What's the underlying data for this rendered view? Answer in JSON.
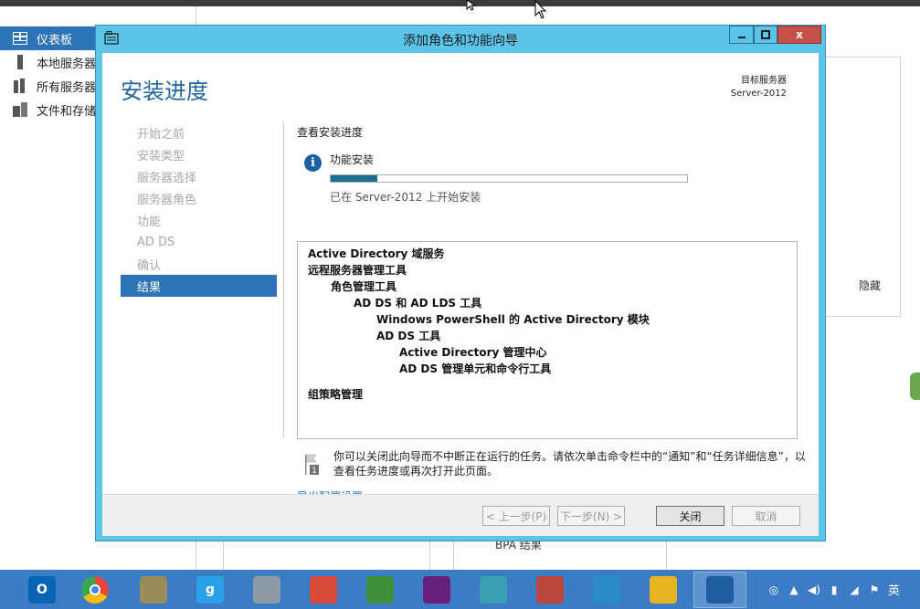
{
  "background": {
    "nav_items": [
      {
        "label": "仪表板",
        "icon": "dashboard-icon",
        "active": true
      },
      {
        "label": "本地服务器",
        "icon": "local-server-icon",
        "active": false
      },
      {
        "label": "所有服务器",
        "icon": "all-servers-icon",
        "active": false
      },
      {
        "label": "文件和存储服务",
        "icon": "file-storage-icon",
        "active": false
      }
    ],
    "hide_label": "隐藏",
    "bpa_label": "BPA 结果"
  },
  "wizard": {
    "title": "添加角色和功能向导",
    "controls": {
      "minimize": "▁",
      "maximize": "☐",
      "close": "x"
    },
    "page_title": "安装进度",
    "target_server_label": "目标服务器",
    "target_server_name": "Server-2012",
    "steps": [
      {
        "label": "开始之前",
        "active": false
      },
      {
        "label": "安装类型",
        "active": false
      },
      {
        "label": "服务器选择",
        "active": false
      },
      {
        "label": "服务器角色",
        "active": false
      },
      {
        "label": "功能",
        "active": false
      },
      {
        "label": "AD DS",
        "active": false
      },
      {
        "label": "确认",
        "active": false
      },
      {
        "label": "结果",
        "active": true
      }
    ],
    "section_title": "查看安装进度",
    "feature_install_label": "功能安装",
    "progress_fraction": 0.13,
    "progress_status": "已在 Server-2012 上开始安装",
    "results": [
      {
        "text": "Active Directory 域服务",
        "level": 0
      },
      {
        "text": "远程服务器管理工具",
        "level": 0
      },
      {
        "text": "角色管理工具",
        "level": 1
      },
      {
        "text": "AD DS 和 AD LDS 工具",
        "level": 2
      },
      {
        "text": "Windows PowerShell 的 Active Directory 模块",
        "level": 3
      },
      {
        "text": "AD DS 工具",
        "level": 3
      },
      {
        "text": "Active Directory 管理中心",
        "level": 4
      },
      {
        "text": "AD DS 管理单元和命令行工具",
        "level": 4
      },
      {
        "text": "",
        "level": 0
      },
      {
        "text": "组策略管理",
        "level": 0
      }
    ],
    "note": "你可以关闭此向导而不中断正在运行的任务。请依次单击命令栏中的“通知”和“任务详细信息”，以查看任务进度或再次打开此页面。",
    "note_badge": "1",
    "export_link": "导出配置设置",
    "buttons": {
      "prev": "< 上一步(P)",
      "next": "下一步(N) >",
      "close": "关闭",
      "cancel": "取消"
    }
  },
  "taskbar": {
    "apps": [
      {
        "icon": "outlook-icon",
        "glyph": "O",
        "color": "#0a64b4"
      },
      {
        "icon": "chrome-icon",
        "glyph": "",
        "color": "#e8453c"
      },
      {
        "icon": "file-cabinet-icon",
        "glyph": "",
        "color": "#9b8a5a"
      },
      {
        "icon": "baidu-input-icon",
        "glyph": "g",
        "color": "#2aa0e8"
      },
      {
        "icon": "calculator-icon",
        "glyph": "",
        "color": "#8c9aa6"
      },
      {
        "icon": "snipping-tool-icon",
        "glyph": "",
        "color": "#d84a3c"
      },
      {
        "icon": "chart-doc-icon",
        "glyph": "",
        "color": "#3f8e3a"
      },
      {
        "icon": "visual-studio-icon",
        "glyph": "",
        "color": "#68217a"
      },
      {
        "icon": "notepad-icon",
        "glyph": "",
        "color": "#3aa0b0"
      },
      {
        "icon": "spreadsheet-icon",
        "glyph": "",
        "color": "#b7463c"
      },
      {
        "icon": "podcast-icon",
        "glyph": "",
        "color": "#2b8ac8"
      },
      {
        "icon": "messenger-icon",
        "glyph": "",
        "color": "#e6b422"
      },
      {
        "icon": "virtualbox-icon",
        "glyph": "",
        "color": "#1f5fa0"
      }
    ],
    "ime_label": "英"
  }
}
